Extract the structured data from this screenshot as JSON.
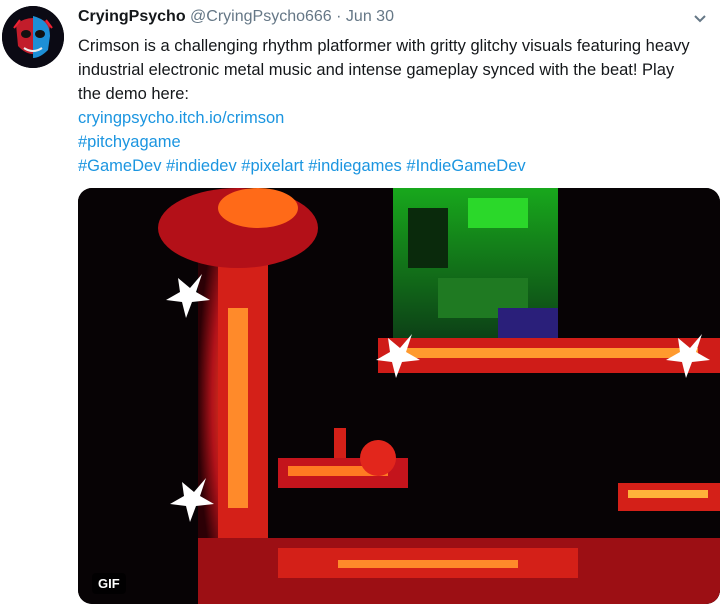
{
  "tweet": {
    "author_name": "CryingPsycho",
    "author_handle": "@CryingPsycho666",
    "separator": "·",
    "date": "Jun 30",
    "text_line": "Crimson is a challenging rhythm platformer with gritty glitchy visuals featuring heavy industrial electronic metal music and intense gameplay synced with the beat! Play the demo here:",
    "link": "cryingpsycho.itch.io/crimson",
    "hashtag_line1": "#pitchyagame",
    "hashtags": [
      "#GameDev",
      "#indiedev",
      "#pixelart",
      "#indiegames",
      "#IndieGameDev"
    ]
  },
  "media": {
    "badge": "GIF"
  },
  "icons": {
    "avatar": "avatar-icon",
    "caret": "chevron-down-icon"
  }
}
